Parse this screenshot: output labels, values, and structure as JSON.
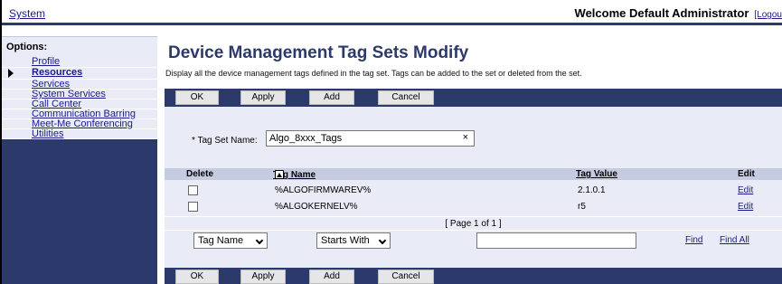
{
  "header": {
    "system_link": "System",
    "welcome": "Welcome Default Administrator",
    "logout": "[Logou"
  },
  "sidebar": {
    "options_label": "Options:",
    "items": [
      {
        "label": "Profile"
      },
      {
        "label": "Resources",
        "current": true
      },
      {
        "label": "Services"
      },
      {
        "label": "System Services"
      },
      {
        "label": "Call Center"
      },
      {
        "label": "Communication Barring"
      },
      {
        "label": "Meet-Me Conferencing"
      },
      {
        "label": "Utilities"
      }
    ]
  },
  "page": {
    "title": "Device Management Tag Sets Modify",
    "description": "Display all the device management tags defined in the tag set. Tags can be added to the set or deleted from the set."
  },
  "buttons": {
    "ok": "OK",
    "apply": "Apply",
    "add": "Add",
    "cancel": "Cancel"
  },
  "form": {
    "tag_set_name_label": "* Tag Set Name:",
    "tag_set_name_value": "Algo_8xxx_Tags",
    "clear_glyph": "×"
  },
  "table": {
    "headers": {
      "delete": "Delete",
      "tag_name": "Tag Name",
      "tag_value": "Tag Value",
      "edit": "Edit"
    },
    "rows": [
      {
        "tag_name": "%ALGOFIRMWAREV%",
        "tag_value": "2.1.0.1",
        "edit": "Edit"
      },
      {
        "tag_name": "%ALGOKERNELV%",
        "tag_value": "r5",
        "edit": "Edit"
      }
    ],
    "pager": "[ Page 1 of 1 ]"
  },
  "search": {
    "field_select": "Tag Name",
    "mode_select": "Starts With",
    "value": "",
    "find": "Find",
    "find_all": "Find All"
  },
  "icons": {
    "current_item": "bullet-arrow-icon",
    "sort": "sort-ascending-icon",
    "dropdown": "chevron-down-icon",
    "clear": "close-icon"
  },
  "colors": {
    "nav_dark": "#2c3a6b",
    "panel_light": "#e9ecf6",
    "header_row": "#c5cbe0",
    "link": "#1a1a8c"
  }
}
